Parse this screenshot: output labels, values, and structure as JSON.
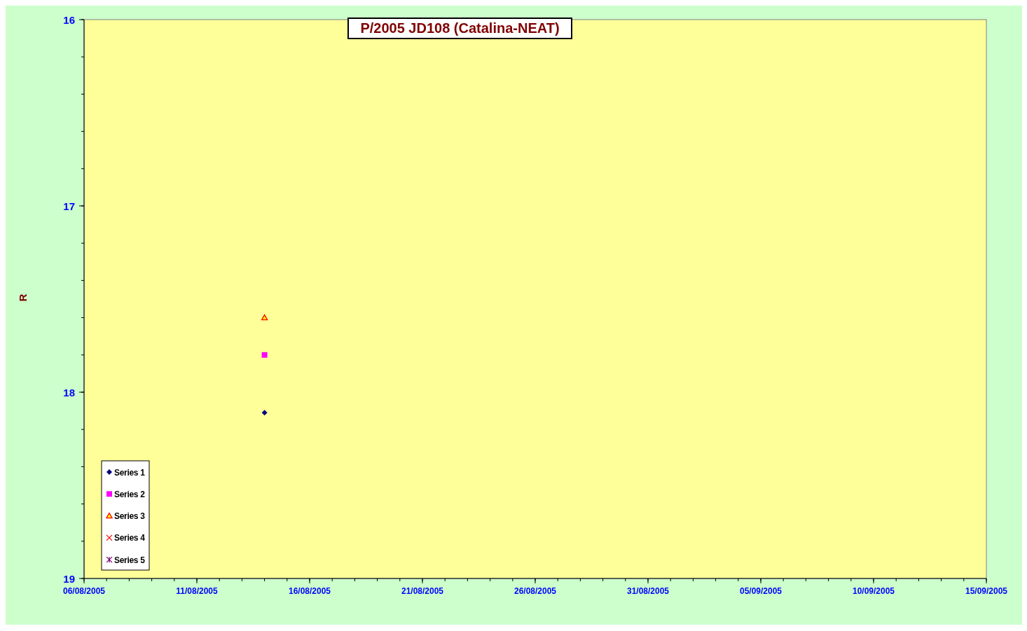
{
  "chart_data": {
    "type": "scatter",
    "title": "P/2005 JD108 (Catalina-NEAT)",
    "ylabel": "R",
    "categories": [
      "06/08/2005",
      null,
      null,
      null,
      null,
      "11/08/2005",
      null,
      null,
      null,
      null,
      "16/08/2005",
      null,
      null,
      null,
      null,
      "21/08/2005",
      null,
      null,
      null,
      null,
      "26/08/2005",
      null,
      null,
      null,
      null,
      "31/08/2005",
      null,
      null,
      null,
      null,
      "05/09/2005",
      null,
      null,
      null,
      null,
      "10/09/2005",
      null,
      null,
      null,
      null,
      "15/09/2005"
    ],
    "series": [
      {
        "name": "Series 1",
        "color": "#000080",
        "values": [
          null,
          null,
          null,
          null,
          null,
          null,
          null,
          null,
          18.11,
          null,
          null,
          null,
          null,
          null,
          null,
          null,
          null,
          null,
          null,
          null,
          null,
          null,
          null,
          null,
          null,
          null,
          null,
          null,
          null,
          null,
          null,
          null,
          null,
          null,
          null,
          null,
          null,
          null,
          null,
          null,
          null
        ]
      },
      {
        "name": "Series 2",
        "color": "#ff00ff",
        "values": [
          null,
          null,
          null,
          null,
          null,
          null,
          null,
          null,
          17.8,
          null,
          null,
          null,
          null,
          null,
          null,
          null,
          null,
          null,
          null,
          null,
          null,
          null,
          null,
          null,
          null,
          null,
          null,
          null,
          null,
          null,
          null,
          null,
          null,
          null,
          null,
          null,
          null,
          null,
          null,
          null,
          null
        ]
      },
      {
        "name": "Series 3",
        "color": "#ff0000",
        "values": [
          null,
          null,
          null,
          null,
          null,
          null,
          null,
          null,
          17.6,
          null,
          null,
          null,
          null,
          null,
          null,
          null,
          null,
          null,
          null,
          null,
          null,
          null,
          null,
          null,
          null,
          null,
          null,
          null,
          null,
          null,
          null,
          null,
          null,
          null,
          null,
          null,
          null,
          null,
          null,
          null,
          null
        ]
      },
      {
        "name": "Series 4",
        "color": "#ff0000",
        "values": [
          null,
          null,
          null,
          null,
          null,
          null,
          null,
          null,
          null,
          null,
          null,
          null,
          null,
          null,
          null,
          null,
          null,
          null,
          null,
          null,
          null,
          null,
          null,
          null,
          null,
          null,
          null,
          null,
          null,
          null,
          null,
          null,
          null,
          null,
          null,
          null,
          null,
          null,
          null,
          null,
          null
        ]
      },
      {
        "name": "Series 5",
        "color": "#800080",
        "values": [
          null,
          null,
          null,
          null,
          null,
          null,
          null,
          null,
          null,
          null,
          null,
          null,
          null,
          null,
          null,
          null,
          null,
          null,
          null,
          null,
          null,
          null,
          null,
          null,
          null,
          null,
          null,
          null,
          null,
          null,
          null,
          null,
          null,
          null,
          null,
          null,
          null,
          null,
          null,
          null,
          null
        ]
      }
    ],
    "ylim": [
      19,
      16
    ],
    "yticks": [
      16,
      17,
      18,
      19
    ],
    "legend": "lower left"
  }
}
